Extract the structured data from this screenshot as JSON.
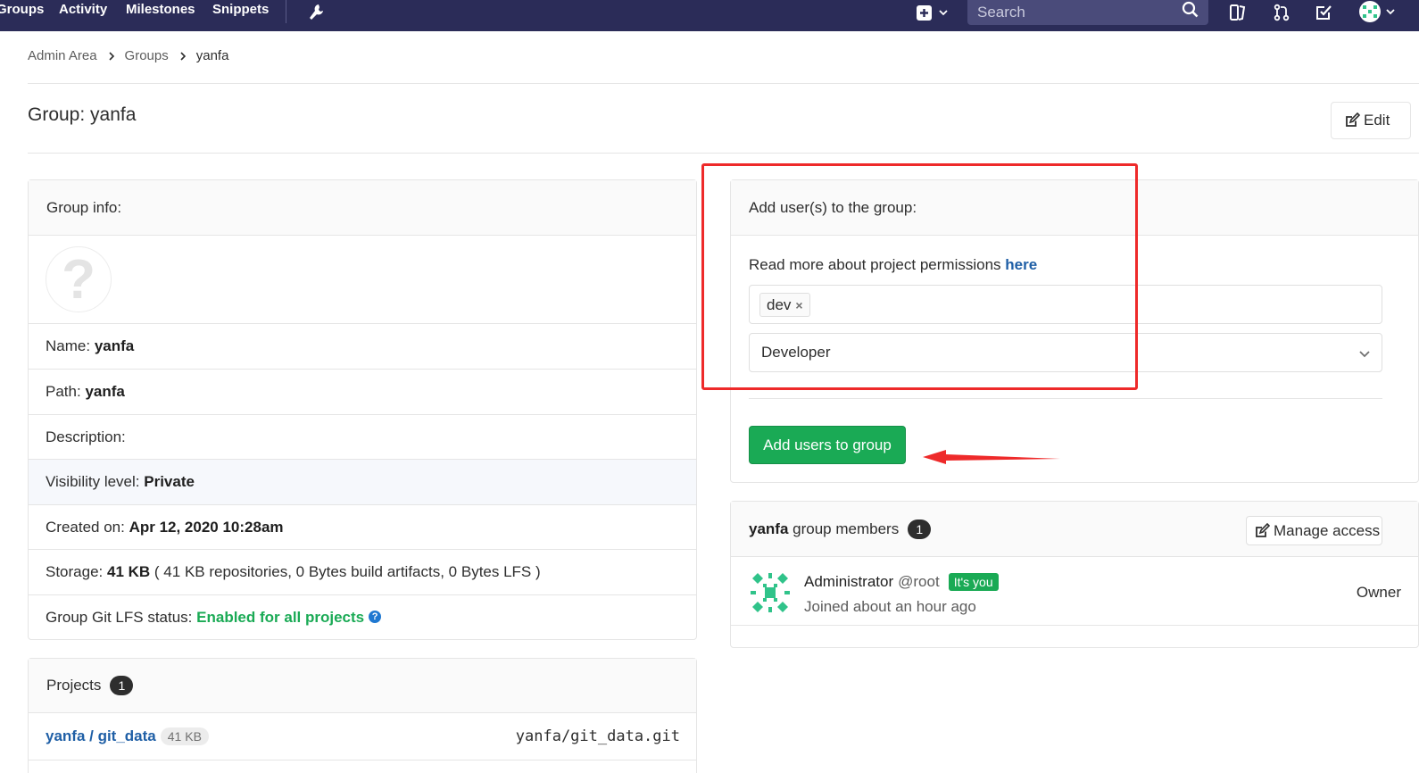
{
  "nav": {
    "links": [
      "Groups",
      "Activity",
      "Milestones",
      "Snippets"
    ],
    "search_placeholder": "Search"
  },
  "breadcrumb": [
    "Admin Area",
    "Groups",
    "yanfa"
  ],
  "page": {
    "title": "Group: yanfa",
    "edit_label": "Edit"
  },
  "group_info": {
    "header": "Group info:",
    "avatar_placeholder": "?",
    "name_label": "Name:",
    "name_value": "yanfa",
    "path_label": "Path:",
    "path_value": "yanfa",
    "description_label": "Description:",
    "visibility_label": "Visibility level:",
    "visibility_value": "Private",
    "created_label": "Created on:",
    "created_value": "Apr 12, 2020 10:28am",
    "storage_label": "Storage:",
    "storage_value": "41 KB",
    "storage_detail": "( 41 KB repositories, 0 Bytes build artifacts, 0 Bytes LFS )",
    "lfs_label": "Group Git LFS status:",
    "lfs_value": "Enabled for all projects",
    "lfs_help": "?"
  },
  "projects": {
    "header": "Projects",
    "count": "1",
    "items": [
      {
        "name": "yanfa / git_data",
        "size": "41 KB",
        "repo_path": "yanfa/git_data.git"
      }
    ]
  },
  "add_users": {
    "header": "Add user(s) to the group:",
    "permissions_text": "Read more about project permissions",
    "permissions_link": "here",
    "selected_user": "dev",
    "token_remove": "×",
    "role": "Developer",
    "submit_label": "Add users to group"
  },
  "members": {
    "group_name": "yanfa",
    "header_suffix": "group members",
    "count": "1",
    "manage_label": "Manage access",
    "items": [
      {
        "name": "Administrator",
        "handle": "@root",
        "badge": "It's you",
        "joined": "Joined about an hour ago",
        "role": "Owner"
      }
    ]
  },
  "colors": {
    "navbar": "#2b2c58",
    "success": "#1aaa55",
    "link": "#1f5fa6",
    "annotation": "#ee2a2a"
  }
}
